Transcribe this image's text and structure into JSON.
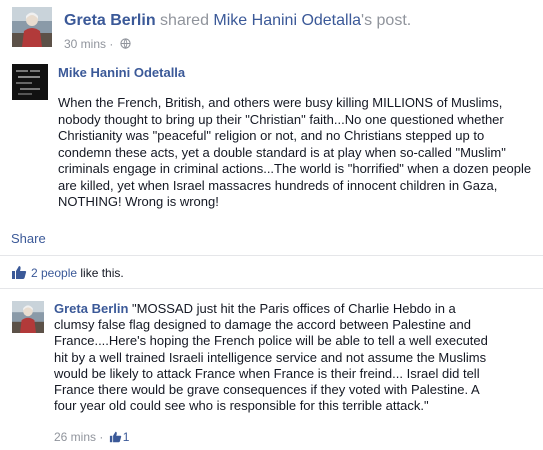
{
  "header": {
    "sharer_name": "Greta Berlin",
    "share_text": " shared ",
    "original_author_possessive": "Mike Hanini Odetalla",
    "post_suffix": "'s post.",
    "time": "30 mins",
    "separator": "·",
    "privacy_icon": "globe-icon"
  },
  "shared_post": {
    "author": "Mike Hanini Odetalla",
    "text": "When the French, British, and others were busy killing MILLIONS of Muslims, nobody thought to bring up their \"Christian\" faith...No one questioned whether Christianity was \"peaceful\" religion or not, and no Christians stepped up to condemn these acts, yet a double standard is at play when so-called \"Muslim\" criminals engage in criminal actions...The world is \"horrified\" when a dozen people are killed, yet when Israel massacres hundreds of innocent children in Gaza, NOTHING! Wrong is wrong!"
  },
  "actions": {
    "share_label": "Share"
  },
  "likes": {
    "icon": "thumbs-up-icon",
    "count_label": "2 people",
    "suffix": " like this."
  },
  "comment": {
    "author": "Greta Berlin",
    "text": " \"MOSSAD just hit the Paris offices of Charlie Hebdo in a clumsy false flag designed to damage the accord between Palestine and France....Here's hoping the French police will be able to tell a well executed hit by a well trained Israeli intelligence service and not assume the Muslims would be likely to attack France when France is their freind... Israel did tell France there would be grave consequences if they voted with Palestine. A four year old could see who is responsible for this terrible attack.\"",
    "time": "26 mins",
    "separator": "·",
    "like_count": "1"
  },
  "colors": {
    "link": "#3b5998",
    "meta": "#90949c",
    "text": "#141823",
    "divider": "#e5e6e9"
  }
}
